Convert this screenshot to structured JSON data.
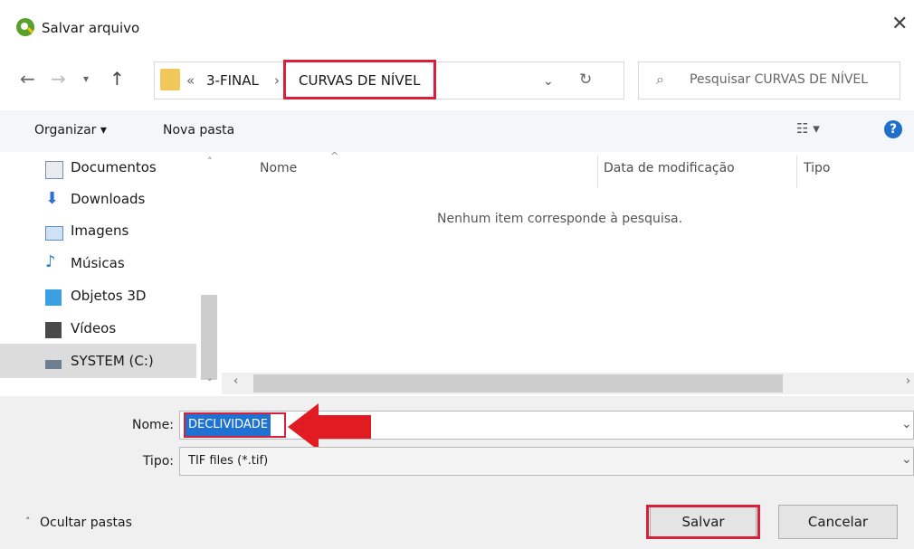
{
  "window": {
    "title": "Salvar arquivo",
    "close_icon": "close-icon",
    "app_icon": "qgis-icon"
  },
  "nav": {
    "breadcrumbs": [
      "«",
      "3-FINAL",
      "›",
      "CURVAS DE NÍVEL"
    ],
    "back_icon": "back-arrow-icon",
    "forward_icon": "forward-arrow-icon",
    "recent_icon": "chevron-down-icon",
    "up_icon": "up-arrow-icon",
    "refresh_icon": "refresh-icon",
    "search_placeholder": "Pesquisar CURVAS DE NÍVEL"
  },
  "toolbar": {
    "organize": "Organizar ▾",
    "new_folder": "Nova pasta",
    "view_icon": "view-options-icon",
    "help": "?"
  },
  "sidebar": {
    "items": [
      {
        "label": "Documentos",
        "icon": "documents-icon",
        "color": "#7d8ea8"
      },
      {
        "label": "Downloads",
        "icon": "downloads-icon",
        "color": "#2f6fd6"
      },
      {
        "label": "Imagens",
        "icon": "images-icon",
        "color": "#5b8fc9"
      },
      {
        "label": "Músicas",
        "icon": "music-icon",
        "color": "#2a7fd0"
      },
      {
        "label": "Objetos 3D",
        "icon": "objects-3d-icon",
        "color": "#3aa0e0"
      },
      {
        "label": "Vídeos",
        "icon": "videos-icon",
        "color": "#4a4a4a"
      },
      {
        "label": "SYSTEM (C:)",
        "icon": "drive-icon",
        "color": "#6d7f91"
      }
    ],
    "selected": "SYSTEM (C:)"
  },
  "filelist": {
    "columns": [
      "Nome",
      "Data de modificação",
      "Tipo"
    ],
    "empty_message": "Nenhum item corresponde à pesquisa."
  },
  "form": {
    "name_label": "Nome:",
    "name_value": "DECLIVIDADE",
    "type_label": "Tipo:",
    "type_value": "TIF files (*.tif)"
  },
  "footer": {
    "hide_folders": "Ocultar pastas",
    "save": "Salvar",
    "cancel": "Cancelar"
  },
  "colors": {
    "highlight": "#d9203a",
    "selection": "#1f72d2",
    "arrow": "#e21b22"
  }
}
